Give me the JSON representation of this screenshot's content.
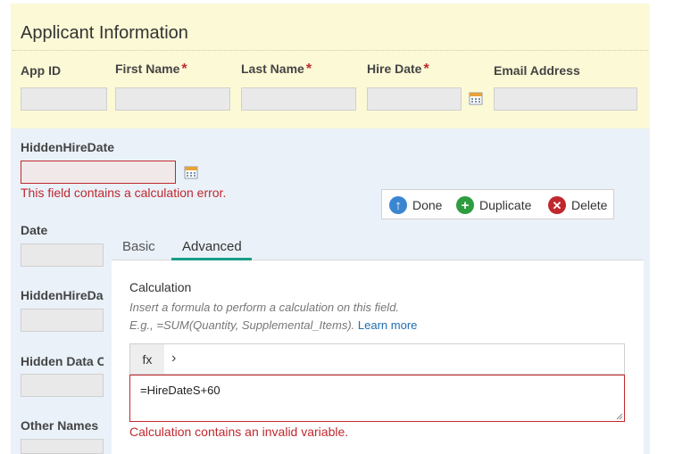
{
  "applicant": {
    "title": "Applicant Information",
    "fields": {
      "app_id": "App ID",
      "first_name": "First Name",
      "last_name": "Last Name",
      "hire_date": "Hire Date",
      "email": "Email Address",
      "required_mark": "*"
    }
  },
  "hidden_hire_date": {
    "label": "HiddenHireDate",
    "error": "This field contains a calculation error."
  },
  "left_fields": [
    "Date",
    "HiddenHireDa",
    "Hidden Data C",
    "Other Names"
  ],
  "toolbar": {
    "done": "Done",
    "duplicate": "Duplicate",
    "delete": "Delete"
  },
  "tabs": [
    "Basic",
    "Advanced"
  ],
  "calc": {
    "label": "Calculation",
    "hint_line1": "Insert a formula to perform a calculation on this field.",
    "hint_line2": "E.g., =SUM(Quantity, Supplemental_Items).",
    "learn_more": "Learn more",
    "fx": "fx",
    "chevron": "›",
    "formula": "=HireDateS+60",
    "error": "Calculation contains an invalid variable."
  },
  "colors": {
    "accent": "#1a9c86",
    "error": "#c0282d",
    "done": "#3a86d0",
    "duplicate": "#2e9d3f",
    "delete": "#c0282d"
  }
}
